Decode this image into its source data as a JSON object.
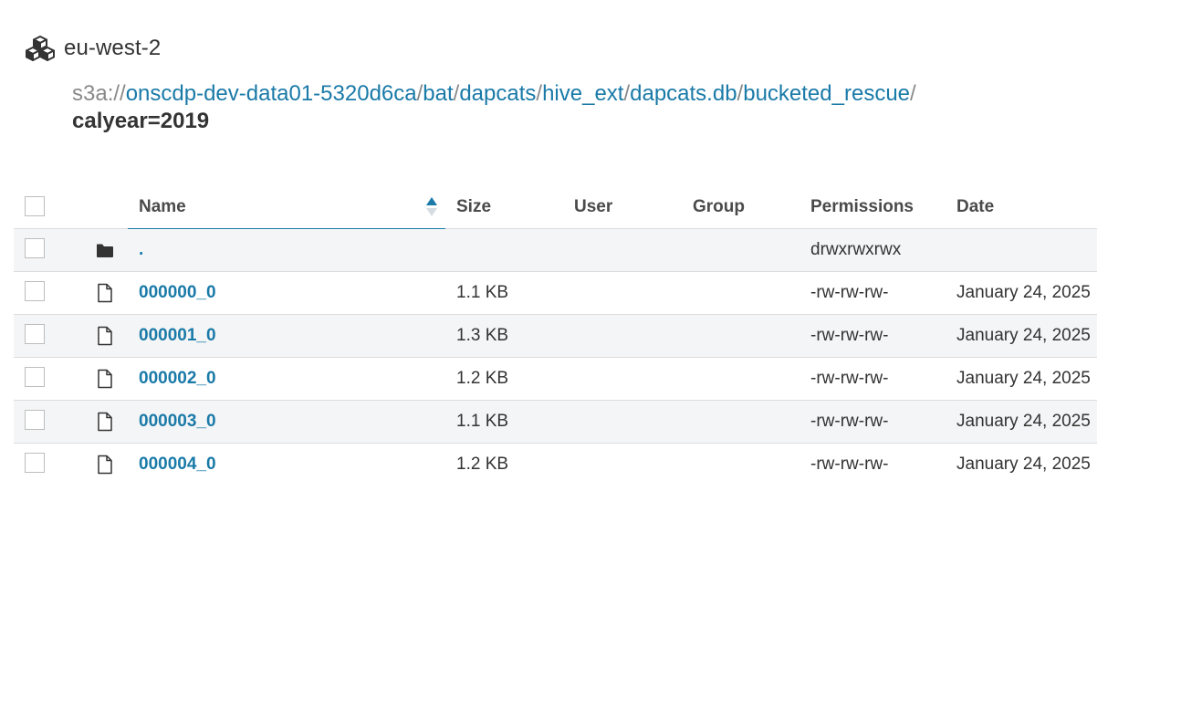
{
  "header": {
    "region": "eu-west-2",
    "icon": "cubes-icon"
  },
  "breadcrumb": {
    "scheme": "s3a://",
    "segments": [
      "onscdp-dev-data01-5320d6ca",
      "bat",
      "dapcats",
      "hive_ext",
      "dapcats.db",
      "bucketed_rescue"
    ],
    "separator": "/",
    "current": "calyear=2019"
  },
  "table": {
    "columns": {
      "name": "Name",
      "size": "Size",
      "user": "User",
      "group": "Group",
      "permissions": "Permissions",
      "date": "Date"
    },
    "sort": {
      "column": "Name",
      "direction": "ascending"
    },
    "rows": [
      {
        "type": "folder",
        "icon": "folder-icon",
        "name": ".",
        "size": "",
        "user": "",
        "group": "",
        "permissions": "drwxrwxrwx",
        "date": ""
      },
      {
        "type": "file",
        "icon": "file-icon",
        "name": "000000_0",
        "size": "1.1 KB",
        "user": "",
        "group": "",
        "permissions": "-rw-rw-rw-",
        "date": "January 24, 2025"
      },
      {
        "type": "file",
        "icon": "file-icon",
        "name": "000001_0",
        "size": "1.3 KB",
        "user": "",
        "group": "",
        "permissions": "-rw-rw-rw-",
        "date": "January 24, 2025"
      },
      {
        "type": "file",
        "icon": "file-icon",
        "name": "000002_0",
        "size": "1.2 KB",
        "user": "",
        "group": "",
        "permissions": "-rw-rw-rw-",
        "date": "January 24, 2025"
      },
      {
        "type": "file",
        "icon": "file-icon",
        "name": "000003_0",
        "size": "1.1 KB",
        "user": "",
        "group": "",
        "permissions": "-rw-rw-rw-",
        "date": "January 24, 2025"
      },
      {
        "type": "file",
        "icon": "file-icon",
        "name": "000004_0",
        "size": "1.2 KB",
        "user": "",
        "group": "",
        "permissions": "-rw-rw-rw-",
        "date": "January 24, 2025"
      }
    ]
  },
  "colors": {
    "link": "#1a7aa8",
    "text": "#333333",
    "muted": "#8a8a8a",
    "row_alt": "#f4f5f6"
  }
}
